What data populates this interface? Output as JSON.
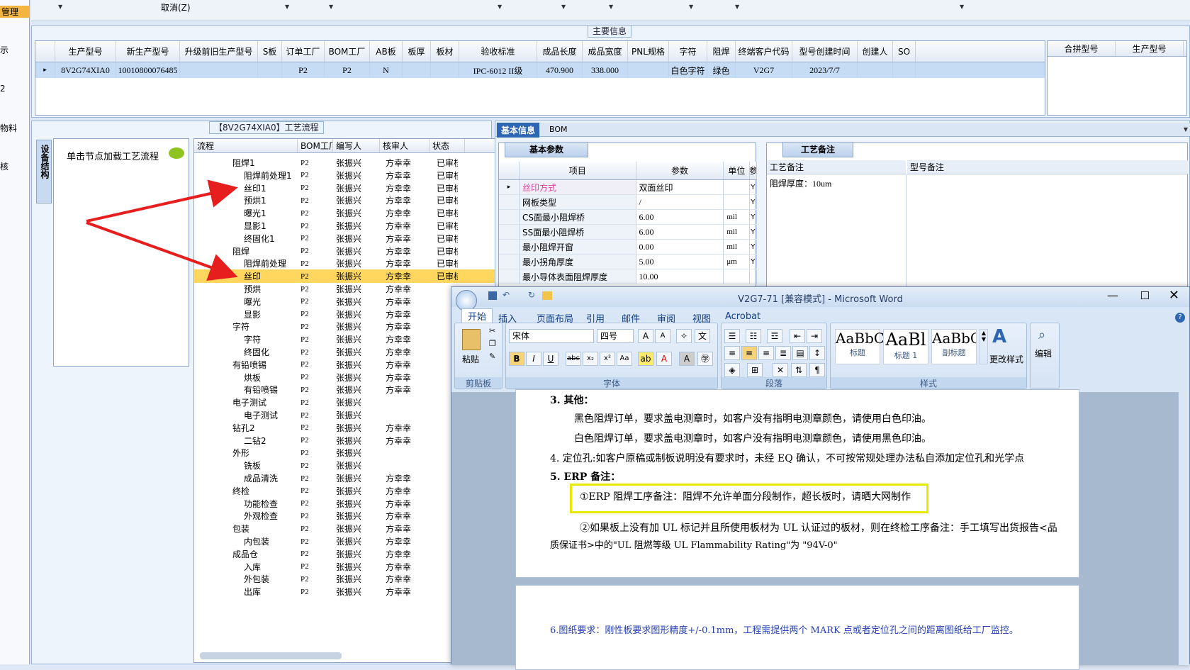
{
  "sidebar": {
    "items": [
      "管理",
      "示",
      "2",
      "物料",
      "核"
    ]
  },
  "topbar": {
    "cancel_label": "取消(Z)"
  },
  "main_info": {
    "title": "主要信息",
    "columns": [
      "生产型号",
      "新生产型号",
      "升级前旧生产型号",
      "S板",
      "订单工厂",
      "BOM工厂",
      "AB板",
      "板厚",
      "板材",
      "验收标准",
      "成品长度",
      "成品宽度",
      "PNL规格",
      "字符",
      "阻焊",
      "终端客户代码",
      "型号创建时间",
      "创建人",
      "SO"
    ],
    "row": [
      "8V2G74XIA0",
      "10010800076485",
      "",
      "",
      "P2",
      "P2",
      "N",
      "",
      "",
      "IPC-6012 II级",
      "470.900",
      "338.000",
      "",
      "白色字符",
      "绿色",
      "V2G7",
      "2023/7/7",
      "",
      ""
    ],
    "side_columns": [
      "合拼型号",
      "生产型号"
    ]
  },
  "flow_panel": {
    "title": "【8V2G74XIA0】工艺流程",
    "side_tab": "设备结构",
    "load_hint": "单击节点加载工艺流程",
    "columns": [
      "流程",
      "BOM工厂",
      "编写人",
      "核审人",
      "状态"
    ],
    "rows": [
      {
        "level": 0,
        "name": "阻焊1",
        "bom": "P2",
        "author": "张振兴",
        "reviewer": "方幸幸",
        "status": "已审核"
      },
      {
        "level": 1,
        "name": "阻焊前处理1",
        "bom": "P2",
        "author": "张振兴",
        "reviewer": "方幸幸",
        "status": "已审核"
      },
      {
        "level": 1,
        "name": "丝印1",
        "bom": "P2",
        "author": "张振兴",
        "reviewer": "方幸幸",
        "status": "已审核"
      },
      {
        "level": 1,
        "name": "预烘1",
        "bom": "P2",
        "author": "张振兴",
        "reviewer": "方幸幸",
        "status": "已审核"
      },
      {
        "level": 1,
        "name": "曝光1",
        "bom": "P2",
        "author": "张振兴",
        "reviewer": "方幸幸",
        "status": "已审核"
      },
      {
        "level": 1,
        "name": "显影1",
        "bom": "P2",
        "author": "张振兴",
        "reviewer": "方幸幸",
        "status": "已审核"
      },
      {
        "level": 1,
        "name": "终固化1",
        "bom": "P2",
        "author": "张振兴",
        "reviewer": "方幸幸",
        "status": "已审核"
      },
      {
        "level": 0,
        "name": "阻焊",
        "bom": "P2",
        "author": "张振兴",
        "reviewer": "方幸幸",
        "status": "已审核"
      },
      {
        "level": 1,
        "name": "阻焊前处理",
        "bom": "P2",
        "author": "张振兴",
        "reviewer": "方幸幸",
        "status": "已审核"
      },
      {
        "level": 1,
        "name": "丝印",
        "bom": "P2",
        "author": "张振兴",
        "reviewer": "方幸幸",
        "status": "已审核",
        "selected": true
      },
      {
        "level": 1,
        "name": "预烘",
        "bom": "P2",
        "author": "张振兴",
        "reviewer": "方幸幸",
        "status": ""
      },
      {
        "level": 1,
        "name": "曝光",
        "bom": "P2",
        "author": "张振兴",
        "reviewer": "方幸幸",
        "status": ""
      },
      {
        "level": 1,
        "name": "显影",
        "bom": "P2",
        "author": "张振兴",
        "reviewer": "方幸幸",
        "status": ""
      },
      {
        "level": 0,
        "name": "字符",
        "bom": "P2",
        "author": "张振兴",
        "reviewer": "方幸幸",
        "status": ""
      },
      {
        "level": 1,
        "name": "字符",
        "bom": "P2",
        "author": "张振兴",
        "reviewer": "方幸幸",
        "status": ""
      },
      {
        "level": 1,
        "name": "终固化",
        "bom": "P2",
        "author": "张振兴",
        "reviewer": "方幸幸",
        "status": ""
      },
      {
        "level": 0,
        "name": "有铅喷锡",
        "bom": "P2",
        "author": "张振兴",
        "reviewer": "方幸幸",
        "status": ""
      },
      {
        "level": 1,
        "name": "烘板",
        "bom": "P2",
        "author": "张振兴",
        "reviewer": "方幸幸",
        "status": ""
      },
      {
        "level": 1,
        "name": "有铅喷锡",
        "bom": "P2",
        "author": "张振兴",
        "reviewer": "方幸幸",
        "status": ""
      },
      {
        "level": 0,
        "name": "电子测试",
        "bom": "P2",
        "author": "张振兴",
        "reviewer": "",
        "status": ""
      },
      {
        "level": 1,
        "name": "电子测试",
        "bom": "P2",
        "author": "张振兴",
        "reviewer": "",
        "status": ""
      },
      {
        "level": 0,
        "name": "钻孔2",
        "bom": "P2",
        "author": "张振兴",
        "reviewer": "方幸幸",
        "status": ""
      },
      {
        "level": 1,
        "name": "二钻2",
        "bom": "P2",
        "author": "张振兴",
        "reviewer": "方幸幸",
        "status": ""
      },
      {
        "level": 0,
        "name": "外形",
        "bom": "P2",
        "author": "张振兴",
        "reviewer": "",
        "status": ""
      },
      {
        "level": 1,
        "name": "铣板",
        "bom": "P2",
        "author": "张振兴",
        "reviewer": "",
        "status": ""
      },
      {
        "level": 1,
        "name": "成品清洗",
        "bom": "P2",
        "author": "张振兴",
        "reviewer": "方幸幸",
        "status": ""
      },
      {
        "level": 0,
        "name": "终检",
        "bom": "P2",
        "author": "张振兴",
        "reviewer": "方幸幸",
        "status": ""
      },
      {
        "level": 1,
        "name": "功能检查",
        "bom": "P2",
        "author": "张振兴",
        "reviewer": "方幸幸",
        "status": ""
      },
      {
        "level": 1,
        "name": "外观检查",
        "bom": "P2",
        "author": "张振兴",
        "reviewer": "方幸幸",
        "status": ""
      },
      {
        "level": 0,
        "name": "包装",
        "bom": "P2",
        "author": "张振兴",
        "reviewer": "方幸幸",
        "status": ""
      },
      {
        "level": 1,
        "name": "内包装",
        "bom": "P2",
        "author": "张振兴",
        "reviewer": "方幸幸",
        "status": ""
      },
      {
        "level": 0,
        "name": "成品仓",
        "bom": "P2",
        "author": "张振兴",
        "reviewer": "方幸幸",
        "status": ""
      },
      {
        "level": 1,
        "name": "入库",
        "bom": "P2",
        "author": "张振兴",
        "reviewer": "方幸幸",
        "status": ""
      },
      {
        "level": 1,
        "name": "外包装",
        "bom": "P2",
        "author": "张振兴",
        "reviewer": "方幸幸",
        "status": ""
      },
      {
        "level": 1,
        "name": "出库",
        "bom": "P2",
        "author": "张振兴",
        "reviewer": "方幸幸",
        "status": ""
      }
    ]
  },
  "right_panel": {
    "tabs": [
      "基本信息",
      "BOM"
    ],
    "basic_params_title": "基本参数",
    "param_columns": [
      "项目",
      "参数",
      "单位",
      "参"
    ],
    "params": [
      {
        "item": "丝印方式",
        "value": "双面丝印",
        "unit": "",
        "flag": "Y"
      },
      {
        "item": "网板类型",
        "value": "/",
        "unit": "",
        "flag": "Y"
      },
      {
        "item": "CS面最小阻焊桥",
        "value": "6.00",
        "unit": "mil",
        "flag": "Y"
      },
      {
        "item": "SS面最小阻焊桥",
        "value": "6.00",
        "unit": "mil",
        "flag": "Y"
      },
      {
        "item": "最小阻焊开窗",
        "value": "0.00",
        "unit": "mil",
        "flag": "Y"
      },
      {
        "item": "最小拐角厚度",
        "value": "5.00",
        "unit": "μm",
        "flag": "Y"
      },
      {
        "item": "最小导体表面阻焊厚度",
        "value": "10.00",
        "unit": "",
        "flag": ""
      }
    ],
    "process_note_title": "工艺备注",
    "process_note_label": "工艺备注",
    "model_note_label": "型号备注",
    "process_note_text": "阻焊厚度：10um"
  },
  "word": {
    "title": "V2G7-71 [兼容模式] - Microsoft Word",
    "tabs": [
      "开始",
      "插入",
      "页面布局",
      "引用",
      "邮件",
      "审阅",
      "视图",
      "Acrobat"
    ],
    "font_name": "宋体",
    "font_size": "四号",
    "groups": [
      "剪贴板",
      "字体",
      "段落",
      "样式",
      "编辑"
    ],
    "paste_label": "粘贴",
    "styles": [
      {
        "preview": "AaBbC",
        "name": "标题"
      },
      {
        "preview": "AaBl",
        "name": "标题 1"
      },
      {
        "preview": "AaBbC",
        "name": "副标题"
      }
    ],
    "change_style": "更改样式",
    "edit_label": "编辑",
    "doc_lines": [
      "3. 其他：",
      "黑色阻焊订单，要求盖电测章时，如客户没有指明电测章颜色，请使用白色印油。",
      "白色阻焊订单，要求盖电测章时，如客户没有指明电测章颜色，请使用黑色印油。",
      "4. 定位孔:如客户原稿或制板说明没有要求时，未经 EQ 确认，不可按常规处理办法私自添加定位孔和光学点",
      "5. ERP 备注：",
      "①ERP 阻焊工序备注：阻焊不允许单面分段制作，超长板时，请晒大网制作",
      "②如果板上没有加 UL 标记并且所使用板材为 UL 认证过的板材，则在终检工序备注：手工填写出货报告<品",
      "质保证书>中的\"UL 阻燃等级 UL Flammability Rating\"为 \"94V-0\"",
      "6.图纸要求：刚性板要求图形精度+/-0.1mm，工程需提供两个 MARK 点或者定位孔之间的距离图纸给工厂监控。"
    ]
  },
  "colors": {
    "accent": "#2f66b3",
    "selection": "#ffd75e",
    "highlight_box": "#e8e800",
    "arrow": "#e61e1e"
  }
}
